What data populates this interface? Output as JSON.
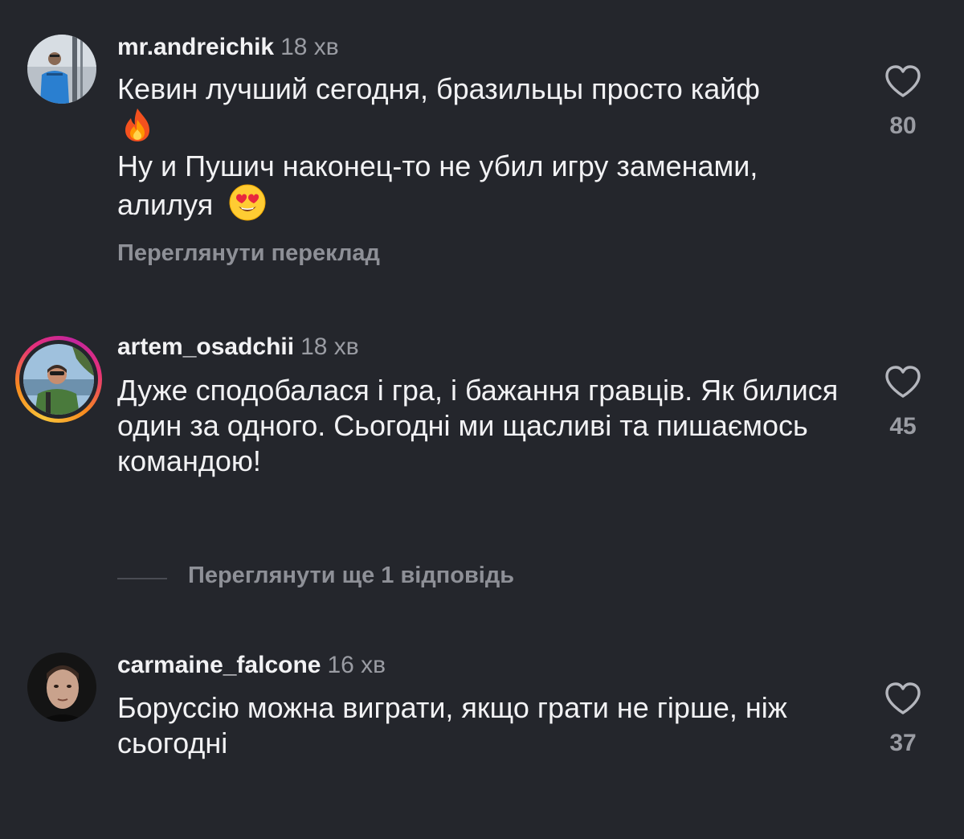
{
  "comments": [
    {
      "username": "mr.andreichik",
      "time": "18 хв",
      "line1": "Кевин лучший сегодня, бразильцы просто кайф",
      "line2": "Ну и Пушич наконец-то не убил игру заменами, алилуя",
      "emoji1": "fire",
      "emoji2": "heart-eyes",
      "translate_label": "Переглянути переклад",
      "likes": "80"
    },
    {
      "username": "artem_osadchii",
      "time": "18 хв",
      "text": "Дуже сподобалася і гра, і бажання гравців. Як билися один за одного. Сьогодні ми щасливі та пишаємось командою!",
      "has_story_ring": true,
      "likes": "45"
    },
    {
      "username": "carmaine_falcone",
      "time": "16 хв",
      "text": "Боруссію можна виграти, якщо грати не гірше, ніж сьогодні",
      "likes": "37"
    }
  ],
  "replies": {
    "label": "Переглянути ще 1 відповідь"
  },
  "colors": {
    "background": "#24262c",
    "text": "#f2f2f4",
    "muted": "#9a9ca3"
  },
  "icons": {
    "like": "heart-outline-icon"
  }
}
